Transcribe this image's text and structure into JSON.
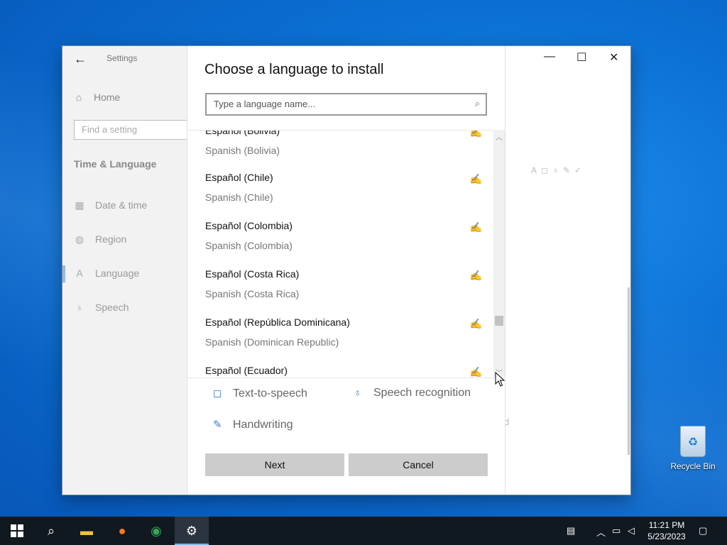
{
  "window": {
    "title": "Settings",
    "controls": {
      "minimize": "—",
      "maximize": "☐",
      "close": "✕"
    }
  },
  "nav": {
    "back": "←",
    "home": "Home",
    "search_placeholder": "Find a setting",
    "section": "Time & Language",
    "items": [
      {
        "label": "Date & time",
        "icon": "calendar-icon"
      },
      {
        "label": "Region",
        "icon": "globe-icon"
      },
      {
        "label": "Language",
        "icon": "language-icon"
      },
      {
        "label": "Speech",
        "icon": "microphone-icon"
      }
    ]
  },
  "background": {
    "partial_text": "d"
  },
  "dialog": {
    "title": "Choose a language to install",
    "search_placeholder": "Type a language name...",
    "languages": [
      {
        "name": "Español (Bolivia)",
        "english": "Spanish (Bolivia)"
      },
      {
        "name": "Español (Chile)",
        "english": "Spanish (Chile)"
      },
      {
        "name": "Español (Colombia)",
        "english": "Spanish (Colombia)"
      },
      {
        "name": "Español (Costa Rica)",
        "english": "Spanish (Costa Rica)"
      },
      {
        "name": "Español (República Dominicana)",
        "english": "Spanish (Dominican Republic)"
      },
      {
        "name": "Español (Ecuador)",
        "english": ""
      }
    ],
    "features": {
      "tts": "Text-to-speech",
      "speech": "Speech recognition",
      "handwriting": "Handwriting"
    },
    "next": "Next",
    "cancel": "Cancel"
  },
  "desktop": {
    "recycle_bin": "Recycle Bin"
  },
  "taskbar": {
    "time": "11:21 PM",
    "date": "5/23/2023"
  }
}
